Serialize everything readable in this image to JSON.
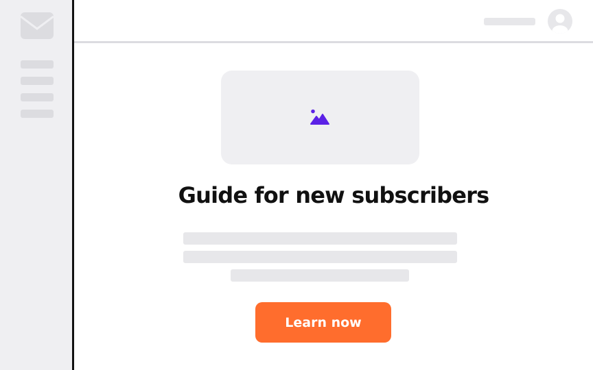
{
  "sidebar": {
    "icon": "mail-icon",
    "nav_item_count": 4
  },
  "header": {
    "avatar_icon": "user-avatar-icon"
  },
  "hero": {
    "image_icon": "image-icon",
    "title": "Guide for new subscribers",
    "cta_label": "Learn now"
  },
  "colors": {
    "accent": "#ff6d2d",
    "icon_purple": "#5b21e6",
    "placeholder": "#e7e7ea",
    "sidebar_bg": "#efeff2",
    "text": "#111111"
  }
}
